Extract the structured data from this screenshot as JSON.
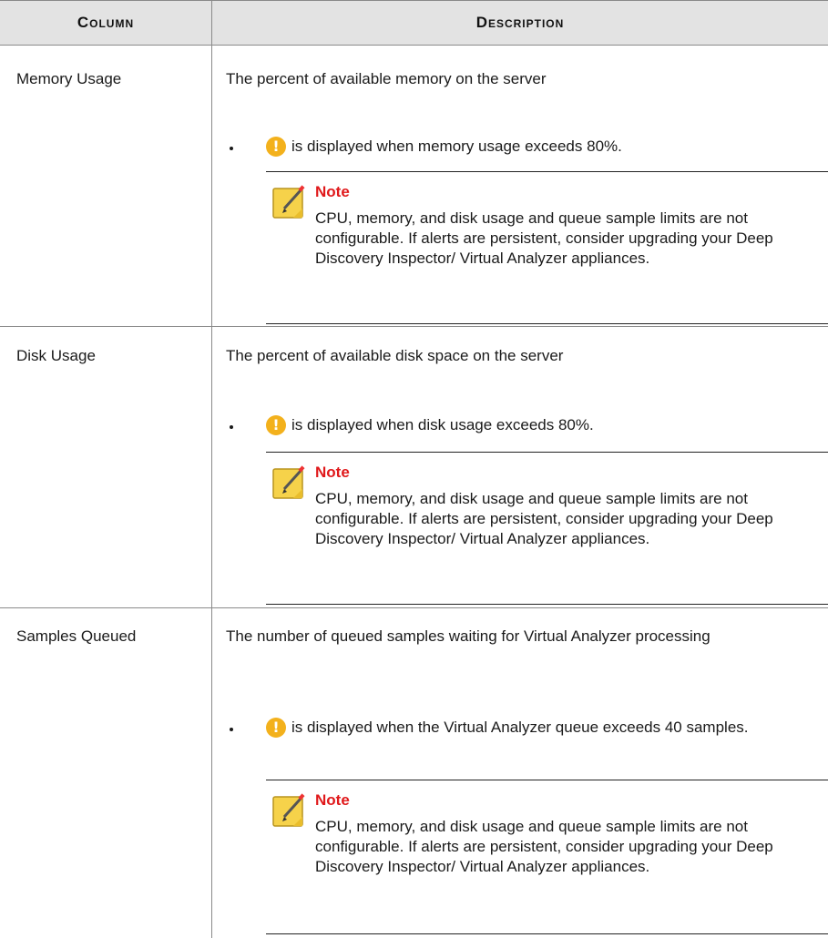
{
  "table": {
    "headers": [
      "Column",
      "Description"
    ],
    "rows": [
      {
        "column": "Memory Usage",
        "description": "The percent of available memory on the server",
        "bullet": "is displayed when memory usage exceeds 80%.",
        "note_title": "Note",
        "note_body": "CPU, memory, and disk usage and queue sample limits are not configurable. If alerts are persistent, consider upgrading your Deep Discovery Inspector/ Virtual Analyzer appliances."
      },
      {
        "column": "Disk Usage",
        "description": "The percent of available disk space on the server",
        "bullet": "is displayed when disk usage exceeds 80%.",
        "note_title": "Note",
        "note_body": "CPU, memory, and disk usage and queue sample limits are not configurable. If alerts are persistent, consider upgrading your Deep Discovery Inspector/ Virtual Analyzer appliances."
      },
      {
        "column": "Samples Queued",
        "description": "The number of queued samples waiting for Virtual Analyzer processing",
        "bullet": "is displayed when the Virtual Analyzer queue exceeds 40 samples.",
        "note_title": "Note",
        "note_body": "CPU, memory, and disk usage and queue sample limits are not configurable. If alerts are persistent, consider upgrading your Deep Discovery Inspector/ Virtual Analyzer appliances."
      }
    ]
  },
  "icons": {
    "alert": "warning-exclamation-icon",
    "note": "note-pencil-icon"
  },
  "colors": {
    "header_bg": "#e3e3e3",
    "alert": "#f3b11c",
    "note_title": "#e0191b",
    "note_icon": "#f6d24a"
  }
}
